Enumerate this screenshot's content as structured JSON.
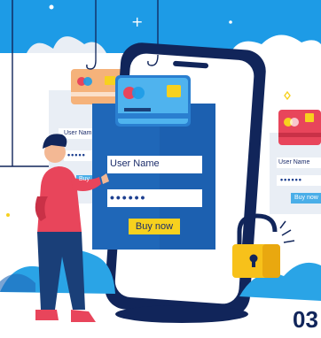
{
  "colors": {
    "primary_blue": "#1d9be6",
    "deep_blue": "#1f67b8",
    "navy": "#11255a",
    "accent_yellow": "#f7d11e",
    "accent_red": "#e8455b",
    "light_gray": "#e9eef5"
  },
  "main_form": {
    "username_label": "User Name",
    "password_mask": "••••••",
    "buy_button_label": "Buy now"
  },
  "left_form": {
    "username_label": "User Nam",
    "password_mask": "•••••",
    "buy_button_label": "Buy"
  },
  "right_form": {
    "username_label": "User Name",
    "password_mask": "••••••",
    "buy_button_label": "Buy now"
  },
  "page_number": "03",
  "icons": [
    "credit-card-icon",
    "padlock-icon",
    "smartphone-icon",
    "fishing-hook-icon",
    "sparkle-icon"
  ]
}
